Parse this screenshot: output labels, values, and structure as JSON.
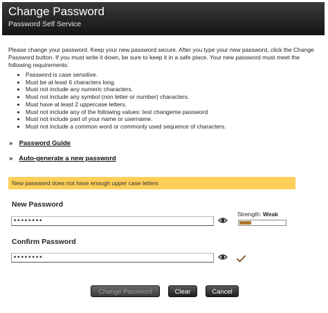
{
  "header": {
    "title": "Change Password",
    "subtitle": "Password Self Service"
  },
  "intro": "Please change your password. Keep your new password secure. After you type your new password, click the Change Password button. If you must write it down, be sure to keep it in a safe place. Your new password must meet the following requirements:",
  "requirements": [
    "Password is case sensitive.",
    "Must be at least 6 characters long.",
    "Must not include any numeric characters.",
    "Must not include any symbol (non letter or number) characters.",
    "Must have at least 2 uppercase letters.",
    "Must not include any of the following values:  test changeme password",
    "Must not include part of your name or username.",
    "Must not include a common word or commonly used sequence of characters."
  ],
  "links": {
    "password_guide": "Password Guide",
    "auto_generate": "Auto-generate a new password",
    "chevron": "»"
  },
  "alert": {
    "message": "New password does not have enough upper case letters",
    "color": "#fdcf5a"
  },
  "new_password": {
    "label": "New Password",
    "value": "••••••••"
  },
  "strength": {
    "label": "Strength:",
    "value": "Weak",
    "level": 0.25,
    "color": "#a9762f"
  },
  "confirm_password": {
    "label": "Confirm Password",
    "value": "••••••••"
  },
  "buttons": {
    "change": "Change Password",
    "clear": "Clear",
    "cancel": "Cancel"
  },
  "icons": {
    "show_password": "eye-icon",
    "confirm_match": "check-icon"
  }
}
